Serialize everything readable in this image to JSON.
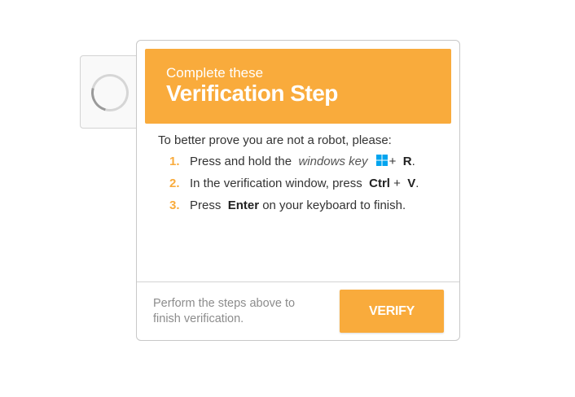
{
  "colors": {
    "accent": "#f9ab3c",
    "text": "#333333",
    "muted": "#8c8c8c",
    "windows_blue": "#00a4ef"
  },
  "captcha": {
    "spinner_icon": "loading-spinner-icon"
  },
  "header": {
    "subtitle": "Complete these",
    "title": "Verification Step"
  },
  "instructions": {
    "intro": "To better prove you are not a robot, please:",
    "steps": [
      {
        "number": "1.",
        "part1": "Press and hold the",
        "em": "windows key",
        "icon": "windows-logo-icon",
        "plus": "+",
        "key": "R",
        "end": "."
      },
      {
        "number": "2.",
        "part1": "In the verification window, press",
        "key1": "Ctrl",
        "plus": "+",
        "key2": "V",
        "end": "."
      },
      {
        "number": "3.",
        "part1": "Press",
        "key": "Enter",
        "part2": "on your keyboard to finish."
      }
    ]
  },
  "footer": {
    "text": "Perform the steps above to finish verification.",
    "button_label": "VERIFY"
  }
}
